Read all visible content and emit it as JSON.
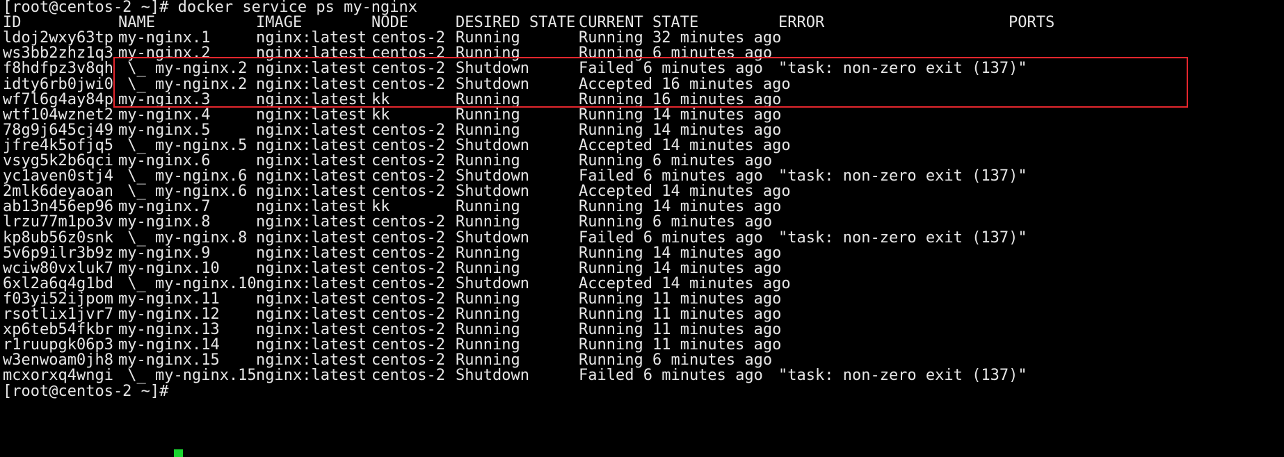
{
  "prompt": "[root@centos-2 ~]# docker service ps my-nginx",
  "next_prompt": "[root@centos-2 ~]#",
  "columns": {
    "id": "ID",
    "name": "NAME",
    "image": "IMAGE",
    "node": "NODE",
    "desired_state": "DESIRED STATE",
    "current_state": "CURRENT STATE",
    "error": "ERROR",
    "ports": "PORTS"
  },
  "rows": [
    {
      "id": "ldoj2wxy63tp",
      "name": "my-nginx.1",
      "image": "nginx:latest",
      "node": "centos-2",
      "desired": "Running",
      "current": "Running 32 minutes ago",
      "error": ""
    },
    {
      "id": "ws3bb2zhz1q3",
      "name": "my-nginx.2",
      "image": "nginx:latest",
      "node": "centos-2",
      "desired": "Running",
      "current": "Running 6 minutes ago",
      "error": ""
    },
    {
      "id": "f8hdfpz3v8qh",
      "name": " \\_ my-nginx.2",
      "image": "nginx:latest",
      "node": "centos-2",
      "desired": "Shutdown",
      "current": "Failed 6 minutes ago",
      "error": "\"task: non-zero exit (137)\""
    },
    {
      "id": "idty6rb0jwi0",
      "name": " \\_ my-nginx.2",
      "image": "nginx:latest",
      "node": "centos-2",
      "desired": "Shutdown",
      "current": "Accepted 16 minutes ago",
      "error": ""
    },
    {
      "id": "wf7l6g4ay84p",
      "name": "my-nginx.3",
      "image": "nginx:latest",
      "node": "kk",
      "desired": "Running",
      "current": "Running 16 minutes ago",
      "error": ""
    },
    {
      "id": "wtf104wznet2",
      "name": "my-nginx.4",
      "image": "nginx:latest",
      "node": "kk",
      "desired": "Running",
      "current": "Running 14 minutes ago",
      "error": ""
    },
    {
      "id": "78g9j645cj49",
      "name": "my-nginx.5",
      "image": "nginx:latest",
      "node": "centos-2",
      "desired": "Running",
      "current": "Running 14 minutes ago",
      "error": ""
    },
    {
      "id": "jfre4k5ofjq5",
      "name": " \\_ my-nginx.5",
      "image": "nginx:latest",
      "node": "centos-2",
      "desired": "Shutdown",
      "current": "Accepted 14 minutes ago",
      "error": ""
    },
    {
      "id": "vsyg5k2b6qci",
      "name": "my-nginx.6",
      "image": "nginx:latest",
      "node": "centos-2",
      "desired": "Running",
      "current": "Running 6 minutes ago",
      "error": ""
    },
    {
      "id": "yc1aven0stj4",
      "name": " \\_ my-nginx.6",
      "image": "nginx:latest",
      "node": "centos-2",
      "desired": "Shutdown",
      "current": "Failed 6 minutes ago",
      "error": "\"task: non-zero exit (137)\""
    },
    {
      "id": "2mlk6deyaoan",
      "name": " \\_ my-nginx.6",
      "image": "nginx:latest",
      "node": "centos-2",
      "desired": "Shutdown",
      "current": "Accepted 14 minutes ago",
      "error": ""
    },
    {
      "id": "ab13n456ep96",
      "name": "my-nginx.7",
      "image": "nginx:latest",
      "node": "kk",
      "desired": "Running",
      "current": "Running 14 minutes ago",
      "error": ""
    },
    {
      "id": "lrzu77m1po3v",
      "name": "my-nginx.8",
      "image": "nginx:latest",
      "node": "centos-2",
      "desired": "Running",
      "current": "Running 6 minutes ago",
      "error": ""
    },
    {
      "id": "kp8ub56z0snk",
      "name": " \\_ my-nginx.8",
      "image": "nginx:latest",
      "node": "centos-2",
      "desired": "Shutdown",
      "current": "Failed 6 minutes ago",
      "error": "\"task: non-zero exit (137)\""
    },
    {
      "id": "5v6p9ilr3b9z",
      "name": "my-nginx.9",
      "image": "nginx:latest",
      "node": "centos-2",
      "desired": "Running",
      "current": "Running 14 minutes ago",
      "error": ""
    },
    {
      "id": "wciw80vxluk7",
      "name": "my-nginx.10",
      "image": "nginx:latest",
      "node": "centos-2",
      "desired": "Running",
      "current": "Running 14 minutes ago",
      "error": ""
    },
    {
      "id": "6xl2a6q4g1bd",
      "name": " \\_ my-nginx.10",
      "image": "nginx:latest",
      "node": "centos-2",
      "desired": "Shutdown",
      "current": "Accepted 14 minutes ago",
      "error": ""
    },
    {
      "id": "f03yi52ijpom",
      "name": "my-nginx.11",
      "image": "nginx:latest",
      "node": "centos-2",
      "desired": "Running",
      "current": "Running 11 minutes ago",
      "error": ""
    },
    {
      "id": "rsotlix1jvr7",
      "name": "my-nginx.12",
      "image": "nginx:latest",
      "node": "centos-2",
      "desired": "Running",
      "current": "Running 11 minutes ago",
      "error": ""
    },
    {
      "id": "xp6teb54fkbr",
      "name": "my-nginx.13",
      "image": "nginx:latest",
      "node": "centos-2",
      "desired": "Running",
      "current": "Running 11 minutes ago",
      "error": ""
    },
    {
      "id": "r1ruupgk06p3",
      "name": "my-nginx.14",
      "image": "nginx:latest",
      "node": "centos-2",
      "desired": "Running",
      "current": "Running 11 minutes ago",
      "error": ""
    },
    {
      "id": "w3enwoam0jh8",
      "name": "my-nginx.15",
      "image": "nginx:latest",
      "node": "centos-2",
      "desired": "Running",
      "current": "Running 6 minutes ago",
      "error": ""
    },
    {
      "id": "mcxorxq4wngi",
      "name": " \\_ my-nginx.15",
      "image": "nginx:latest",
      "node": "centos-2",
      "desired": "Shutdown",
      "current": "Failed 6 minutes ago",
      "error": "\"task: non-zero exit (137)\""
    }
  ],
  "colors": {
    "background": "#000000",
    "text": "#e6e6e6",
    "highlight_box": "#e3262d",
    "cursor": "#19d62f"
  }
}
